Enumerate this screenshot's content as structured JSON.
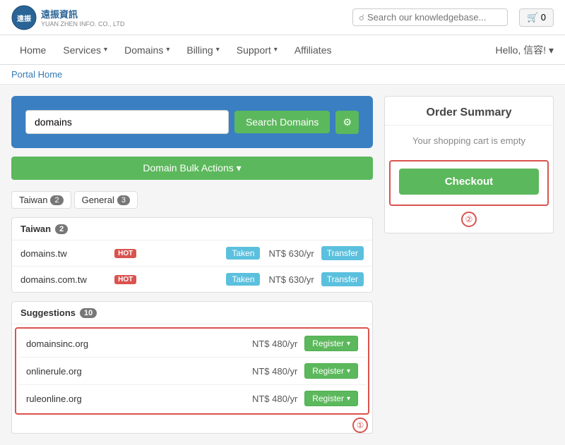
{
  "brand": {
    "logo_text_line1": "遠振資訊",
    "logo_text_line2": "YUAN ZHEN INFO. CO., LTD"
  },
  "topnav": {
    "search_placeholder": "Search our knowledgebase...",
    "cart_count": "0"
  },
  "mainnav": {
    "items": [
      {
        "label": "Home",
        "has_dropdown": false
      },
      {
        "label": "Services",
        "has_dropdown": true
      },
      {
        "label": "Domains",
        "has_dropdown": true
      },
      {
        "label": "Billing",
        "has_dropdown": true
      },
      {
        "label": "Support",
        "has_dropdown": true
      },
      {
        "label": "Affiliates",
        "has_dropdown": false
      }
    ],
    "user_greeting": "Hello, 信容! ▾"
  },
  "breadcrumb": {
    "label": "Portal Home"
  },
  "domain_search": {
    "input_value": "domains",
    "search_button": "Search Domains"
  },
  "bulk_actions": {
    "label": "Domain Bulk Actions ▾"
  },
  "tabs": [
    {
      "label": "Taiwan",
      "count": "2"
    },
    {
      "label": "General",
      "count": "3"
    }
  ],
  "taiwan_section": {
    "header": "Taiwan",
    "count": "2",
    "rows": [
      {
        "name": "domains.tw",
        "hot": true,
        "status": "Taken",
        "price": "NT$ 630/yr",
        "action": "Transfer"
      },
      {
        "name": "domains.com.tw",
        "hot": true,
        "status": "Taken",
        "price": "NT$ 630/yr",
        "action": "Transfer"
      }
    ]
  },
  "suggestions_section": {
    "header": "Suggestions",
    "count": "10",
    "rows": [
      {
        "name": "domainsinc.org",
        "price": "NT$ 480/yr",
        "action": "Register"
      },
      {
        "name": "onlinerule.org",
        "price": "NT$ 480/yr",
        "action": "Register"
      },
      {
        "name": "ruleonline.org",
        "price": "NT$ 480/yr",
        "action": "Register"
      }
    ]
  },
  "order_summary": {
    "title": "Order Summary",
    "empty_text": "Your shopping cart is empty",
    "checkout_label": "Checkout",
    "circle2": "②"
  },
  "annotations": {
    "circle1": "①"
  }
}
